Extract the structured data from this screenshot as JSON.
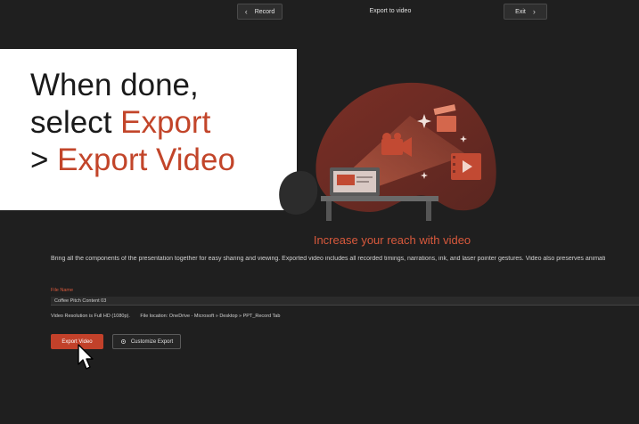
{
  "toolbar": {
    "record_label": "Record",
    "title": "Export to video",
    "exit_label": "Exit"
  },
  "caption": {
    "line1": "When done,",
    "line2_prefix": "select ",
    "line2_accent": "Export",
    "line3_prefix": "> ",
    "line3_accent": "Export Video"
  },
  "main": {
    "headline": "Increase your reach with video",
    "description": "Bring all the components of the presentation together for easy sharing and viewing. Exported video includes all recorded timings, narrations, ink, and laser pointer gestures. Video also preserves animati",
    "file_name_label": "File Name",
    "file_name_value": "Coffee Pitch Content 03",
    "resolution_text": "Video Resolution is Full HD (1080p).",
    "location_text": "File location: OneDrive - Microsoft » Desktop » PPT_Record Tab",
    "export_button": "Export Video",
    "customize_button": "Customize Export"
  },
  "colors": {
    "accent": "#c2452a",
    "background": "#1f1f1f"
  },
  "icons": [
    "chevron-left-icon",
    "chevron-right-icon",
    "gear-icon",
    "mouse-pointer-icon",
    "video-camera-icon",
    "clapperboard-icon",
    "film-icon",
    "laptop-icon"
  ]
}
